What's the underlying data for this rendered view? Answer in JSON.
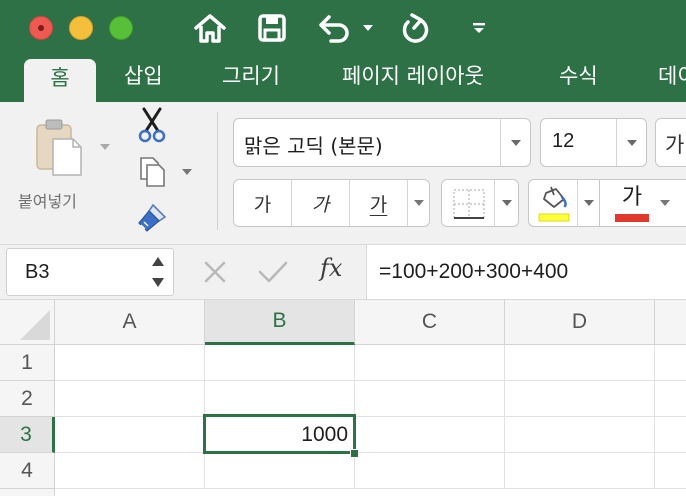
{
  "quick_access": {
    "home_icon": "home-icon",
    "save_icon": "save-icon",
    "undo_icon": "undo-icon",
    "redo_icon": "redo-icon",
    "customize_icon": "customize-toolbar-icon"
  },
  "tabs": [
    {
      "label": "홈",
      "active": true
    },
    {
      "label": "삽입"
    },
    {
      "label": "그리기"
    },
    {
      "label": "페이지 레이아웃"
    },
    {
      "label": "수식"
    },
    {
      "label": "데이"
    }
  ],
  "ribbon": {
    "paste_label": "붙여넣기",
    "font_name": "맑은 고딕 (본문)",
    "font_size": "12",
    "grow_font_label": "가",
    "bold_label": "가",
    "italic_label": "가",
    "underline_label": "가",
    "font_color_label": "가",
    "fill_color": "#ffff3b",
    "font_color": "#e03a2f"
  },
  "formula_bar": {
    "name_box": "B3",
    "fx_label": "fx",
    "formula": "=100+200+300+400"
  },
  "sheet": {
    "columns": [
      "A",
      "B",
      "C",
      "D"
    ],
    "rows": [
      "1",
      "2",
      "3",
      "4"
    ],
    "selected_cell": "B3",
    "cells": {
      "B3": "1000"
    }
  },
  "colors": {
    "accent": "#2f7146",
    "ribbon_bg": "#f1f1f1"
  }
}
